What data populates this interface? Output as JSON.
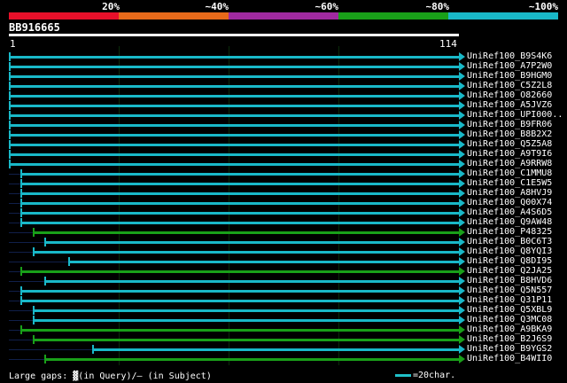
{
  "scale": {
    "labels": [
      "20%",
      "~40%",
      "~60%",
      "~80%",
      "~100%"
    ],
    "colors": [
      "#e8102a",
      "#e86a1a",
      "#a02aa0",
      "#19a019",
      "#19b8c8"
    ]
  },
  "query": {
    "name": "BB916665",
    "start": "1",
    "end": "114",
    "length": 114
  },
  "hits": [
    {
      "name": "UniRef100_B9S4K6",
      "start": 1,
      "end": 114,
      "identity_color": "#19b8c8"
    },
    {
      "name": "UniRef100_A7P2W0",
      "start": 1,
      "end": 114,
      "identity_color": "#19b8c8"
    },
    {
      "name": "UniRef100_B9HGM0",
      "start": 1,
      "end": 114,
      "identity_color": "#19b8c8"
    },
    {
      "name": "UniRef100_C5Z2L8",
      "start": 1,
      "end": 114,
      "identity_color": "#19b8c8"
    },
    {
      "name": "UniRef100_O82660",
      "start": 1,
      "end": 114,
      "identity_color": "#19b8c8"
    },
    {
      "name": "UniRef100_A5JVZ6",
      "start": 1,
      "end": 114,
      "identity_color": "#19b8c8"
    },
    {
      "name": "UniRef100_UPI000..",
      "start": 1,
      "end": 114,
      "identity_color": "#19b8c8"
    },
    {
      "name": "UniRef100_B9FR06",
      "start": 1,
      "end": 114,
      "identity_color": "#19b8c8"
    },
    {
      "name": "UniRef100_B8B2X2",
      "start": 1,
      "end": 114,
      "identity_color": "#19b8c8"
    },
    {
      "name": "UniRef100_Q5Z5A8",
      "start": 1,
      "end": 114,
      "identity_color": "#19b8c8"
    },
    {
      "name": "UniRef100_A9T9I6",
      "start": 1,
      "end": 114,
      "identity_color": "#19b8c8"
    },
    {
      "name": "UniRef100_A9RRW8",
      "start": 1,
      "end": 114,
      "identity_color": "#19b8c8"
    },
    {
      "name": "UniRef100_C1MMU8",
      "start": 4,
      "end": 114,
      "identity_color": "#19b8c8"
    },
    {
      "name": "UniRef100_C1E5W5",
      "start": 4,
      "end": 114,
      "identity_color": "#19b8c8"
    },
    {
      "name": "UniRef100_A8HVJ9",
      "start": 4,
      "end": 114,
      "identity_color": "#19b8c8"
    },
    {
      "name": "UniRef100_Q00X74",
      "start": 4,
      "end": 114,
      "identity_color": "#19b8c8"
    },
    {
      "name": "UniRef100_A4S6D5",
      "start": 4,
      "end": 114,
      "identity_color": "#19b8c8"
    },
    {
      "name": "UniRef100_Q9AW48",
      "start": 4,
      "end": 114,
      "identity_color": "#19b8c8"
    },
    {
      "name": "UniRef100_P48325",
      "start": 7,
      "end": 114,
      "identity_color": "#19a019"
    },
    {
      "name": "UniRef100_B0C6T3",
      "start": 10,
      "end": 114,
      "identity_color": "#19b8c8"
    },
    {
      "name": "UniRef100_Q8YQI3",
      "start": 7,
      "end": 114,
      "identity_color": "#19b8c8"
    },
    {
      "name": "UniRef100_Q8DI95",
      "start": 16,
      "end": 114,
      "identity_color": "#19b8c8"
    },
    {
      "name": "UniRef100_Q2JA25",
      "start": 4,
      "end": 114,
      "identity_color": "#19a019"
    },
    {
      "name": "UniRef100_B8HVD6",
      "start": 10,
      "end": 114,
      "identity_color": "#19b8c8"
    },
    {
      "name": "UniRef100_Q5N557",
      "start": 4,
      "end": 114,
      "identity_color": "#19b8c8"
    },
    {
      "name": "UniRef100_Q31P11",
      "start": 4,
      "end": 114,
      "identity_color": "#19b8c8"
    },
    {
      "name": "UniRef100_Q5XBL9",
      "start": 7,
      "end": 114,
      "identity_color": "#19b8c8"
    },
    {
      "name": "UniRef100_Q3MC08",
      "start": 7,
      "end": 114,
      "identity_color": "#19b8c8"
    },
    {
      "name": "UniRef100_A9BKA9",
      "start": 4,
      "end": 114,
      "identity_color": "#19a019"
    },
    {
      "name": "UniRef100_B2J6S9",
      "start": 7,
      "end": 114,
      "identity_color": "#19a019"
    },
    {
      "name": "UniRef100_B9YGS2",
      "start": 22,
      "end": 114,
      "identity_color": "#19b8c8"
    },
    {
      "name": "UniRef100_B4WII0",
      "start": 10,
      "end": 114,
      "identity_color": "#19a019"
    }
  ],
  "footer": {
    "large_gaps": "Large gaps:",
    "query_marker": "▓",
    "in_query": "(in Query)/",
    "subject_marker": "–",
    "in_subject": "(in Subject)",
    "scale_text": "=20char."
  }
}
